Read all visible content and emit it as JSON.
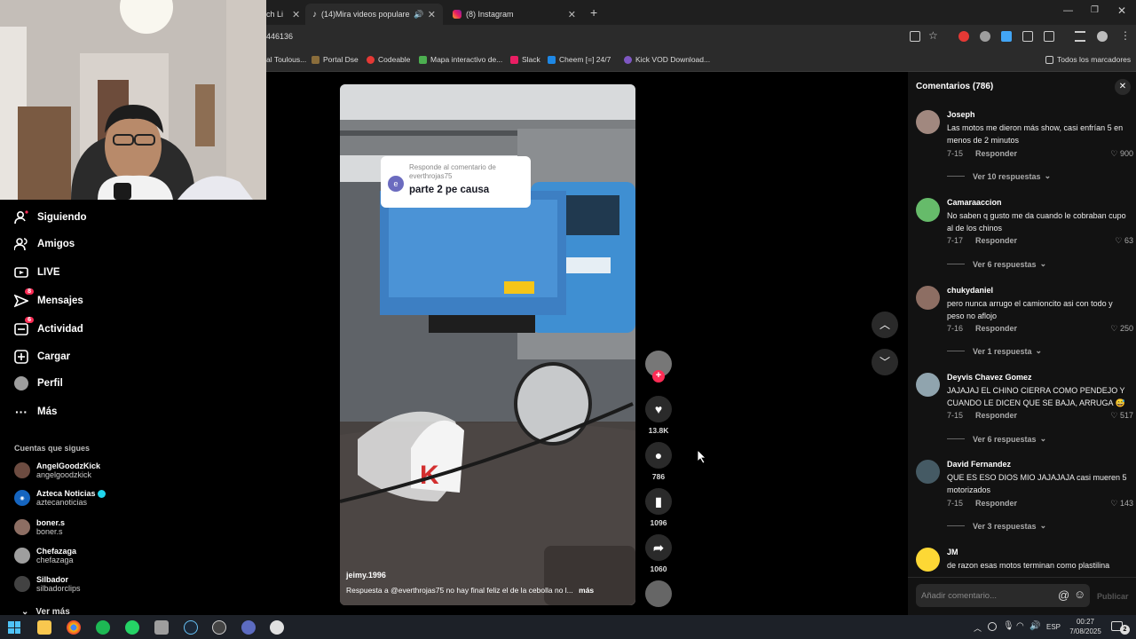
{
  "browser": {
    "tabs": [
      {
        "label": "ch Li"
      },
      {
        "label": "(14)Mira videos populares"
      },
      {
        "label": "(8) Instagram"
      }
    ],
    "url": "446136",
    "bookmarks": [
      {
        "label": "al Toulous...",
        "color": "#888888"
      },
      {
        "label": "Portal Dse",
        "color": "#8a6d3b"
      },
      {
        "label": "Codeable",
        "color": "#e53935"
      },
      {
        "label": "Mapa interactivo de...",
        "color": "#4caf50"
      },
      {
        "label": "Slack",
        "color": "#e91e63"
      },
      {
        "label": "Cheem [=] 24/7",
        "color": "#1e88e5"
      },
      {
        "label": "Kick VOD Download...",
        "color": "#7e57c2"
      }
    ],
    "all_bookmarks": "Todos los marcadores"
  },
  "nav": {
    "items": [
      {
        "label": "Siguiendo",
        "icon": "following-icon"
      },
      {
        "label": "Amigos",
        "icon": "friends-icon"
      },
      {
        "label": "LIVE",
        "icon": "live-icon"
      },
      {
        "label": "Mensajes",
        "icon": "messages-icon",
        "badge": "8"
      },
      {
        "label": "Actividad",
        "icon": "activity-icon",
        "badge": "6"
      },
      {
        "label": "Cargar",
        "icon": "upload-icon"
      },
      {
        "label": "Perfil",
        "icon": "profile-icon"
      },
      {
        "label": "Más",
        "icon": "more-icon"
      }
    ],
    "following_title": "Cuentas que sigues",
    "following": [
      {
        "name": "AngelGoodzKick",
        "handle": "angelgoodzkick",
        "color": "#6d4c41"
      },
      {
        "name": "Azteca Noticias",
        "handle": "aztecanoticias",
        "color": "#1565c0",
        "verified": true
      },
      {
        "name": "boner.s",
        "handle": "boner.s",
        "color": "#8d6e63"
      },
      {
        "name": "Chefazaga",
        "handle": "chefazaga",
        "color": "#9e9e9e"
      },
      {
        "name": "Silbador",
        "handle": "silbadorclips",
        "color": "#424242"
      }
    ],
    "see_more": "Ver más"
  },
  "video": {
    "reply_header": "Responde al comentario de everthrojas75",
    "reply_text": "parte 2 pe causa",
    "reply_avatar_letter": "e",
    "author": "jeimy.1996",
    "caption": "Respuesta a @everthrojas75  no hay final feliz el de la cebolla no l...",
    "caption_more": "más"
  },
  "actions": {
    "likes": "13.8K",
    "comments": "786",
    "saves": "1096",
    "shares": "1060"
  },
  "comments": {
    "title": "Comentarios (786)",
    "items": [
      {
        "name": "Joseph",
        "text": "Las motos me dieron más show, casi enfrían 5 en menos de 2 minutos",
        "date": "7-15",
        "reply": "Responder",
        "likes": "900",
        "more": "Ver 10 respuestas",
        "color": "#a1887f"
      },
      {
        "name": "Camaraaccion",
        "text": "No saben q gusto me da cuando le cobraban cupo al de los chinos",
        "date": "7-17",
        "reply": "Responder",
        "likes": "63",
        "more": "Ver 6 respuestas",
        "color": "#66bb6a"
      },
      {
        "name": "chukydaniel",
        "text": "pero nunca arrugo el camioncito asi con todo y peso no aflojo",
        "date": "7-16",
        "reply": "Responder",
        "likes": "250",
        "more": "Ver 1 respuesta",
        "color": "#8d6e63"
      },
      {
        "name": "Deyvis Chavez Gomez",
        "text": "JAJAJAJ EL CHINO CIERRA COMO PENDEJO Y CUANDO LE DICEN QUE SE BAJA, ARRUGA 😅",
        "date": "7-15",
        "reply": "Responder",
        "likes": "517",
        "more": "Ver 6 respuestas",
        "color": "#90a4ae"
      },
      {
        "name": "David Fernandez",
        "text": "QUE ES ESO DIOS MIO JAJAJAJA casi mueren 5 motorizados",
        "date": "7-15",
        "reply": "Responder",
        "likes": "143",
        "more": "Ver 3 respuestas",
        "color": "#455a64"
      },
      {
        "name": "JM",
        "text": "de razon esas motos terminan como plastilina",
        "color": "#fdd835"
      }
    ],
    "input_placeholder": "Añadir comentario...",
    "publish": "Publicar"
  },
  "taskbar": {
    "lang": "ESP",
    "time": "00:27",
    "date": "7/08/2025",
    "notif": "2"
  }
}
